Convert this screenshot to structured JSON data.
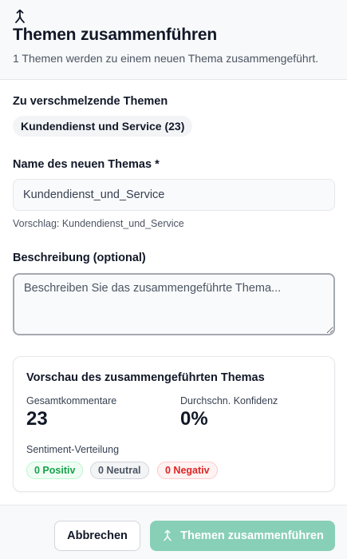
{
  "dialog": {
    "icon": "merge-icon",
    "title": "Themen zusammenführen",
    "subtitle": "1 Themen werden zu einem neuen Thema zusammengeführt."
  },
  "topics_section": {
    "label": "Zu verschmelzende Themen",
    "topics": [
      "Kundendienst und Service (23)"
    ]
  },
  "name_field": {
    "label": "Name des neuen Themas *",
    "value": "Kundendienst_und_Service",
    "hint": "Vorschlag: Kundendienst_und_Service"
  },
  "description_field": {
    "label": "Beschreibung (optional)",
    "placeholder": "Beschreiben Sie das zusammengeführte Thema..."
  },
  "preview": {
    "title": "Vorschau des zusammengeführten Themas",
    "total_comments_label": "Gesamtkommentare",
    "total_comments_value": "23",
    "avg_confidence_label": "Durchschn. Konfidenz",
    "avg_confidence_value": "0%",
    "sentiment_label": "Sentiment-Verteilung",
    "sentiments": {
      "positive": "0 Positiv",
      "neutral": "0 Neutral",
      "negative": "0 Negativ"
    }
  },
  "footer": {
    "cancel_label": "Abbrechen",
    "merge_label": "Themen zusammenführen"
  },
  "colors": {
    "primary_disabled": "#88cfb8",
    "positive": "#16a34a",
    "neutral": "#4b5563",
    "negative": "#dc2626"
  }
}
